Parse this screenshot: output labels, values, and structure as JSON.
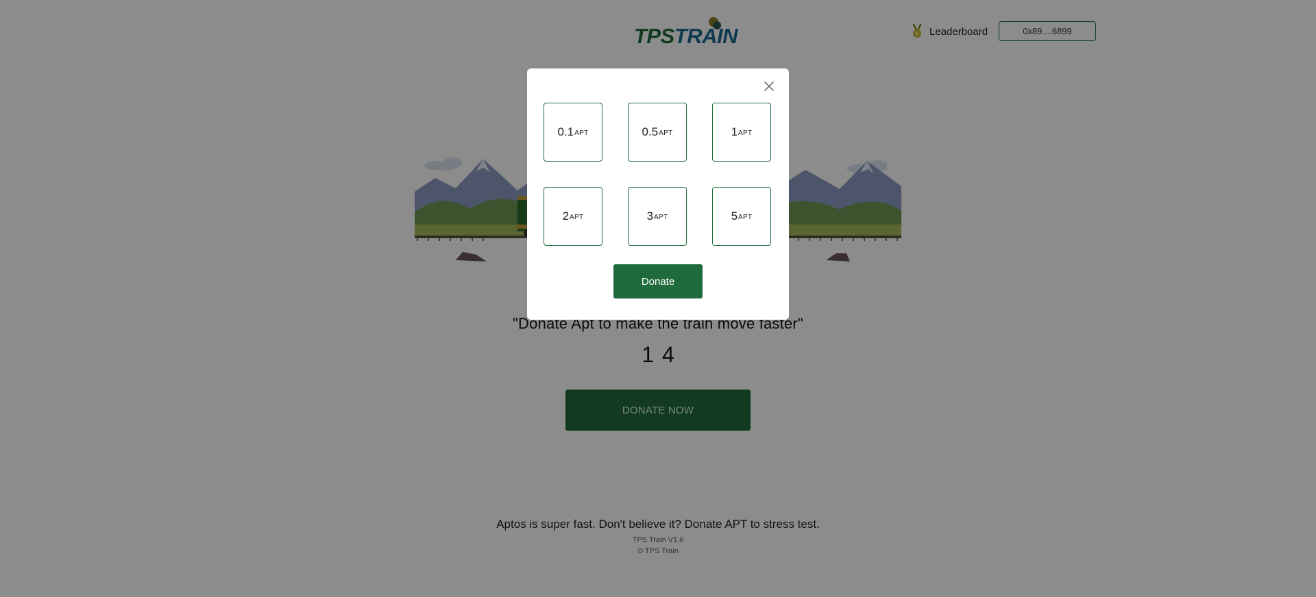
{
  "header": {
    "logo_left": "TPS",
    "logo_right": "TRAIN",
    "leaderboard_label": "Leaderboard",
    "wallet_address": "0x89....6899"
  },
  "main": {
    "cta_text": "\"Donate Apt to make the train move faster\"",
    "counter": "14",
    "donate_now_label": "DONATE NOW"
  },
  "footer": {
    "tagline": "Aptos is super fast. Don't believe it? Donate APT to stress test.",
    "version": "TPS Train V1.6",
    "copyright": "© TPS Train"
  },
  "modal": {
    "amounts": [
      {
        "value": "0.1",
        "unit": "APT"
      },
      {
        "value": "0.5",
        "unit": "APT"
      },
      {
        "value": "1",
        "unit": "APT"
      },
      {
        "value": "2",
        "unit": "APT"
      },
      {
        "value": "3",
        "unit": "APT"
      },
      {
        "value": "5",
        "unit": "APT"
      }
    ],
    "donate_label": "Donate"
  },
  "colors": {
    "brand_green": "#1f6b3b",
    "brand_blue": "#1d6b8f",
    "overlay": "rgba(0,0,0,0.45)"
  },
  "icons": [
    "medal-icon",
    "close-icon"
  ]
}
